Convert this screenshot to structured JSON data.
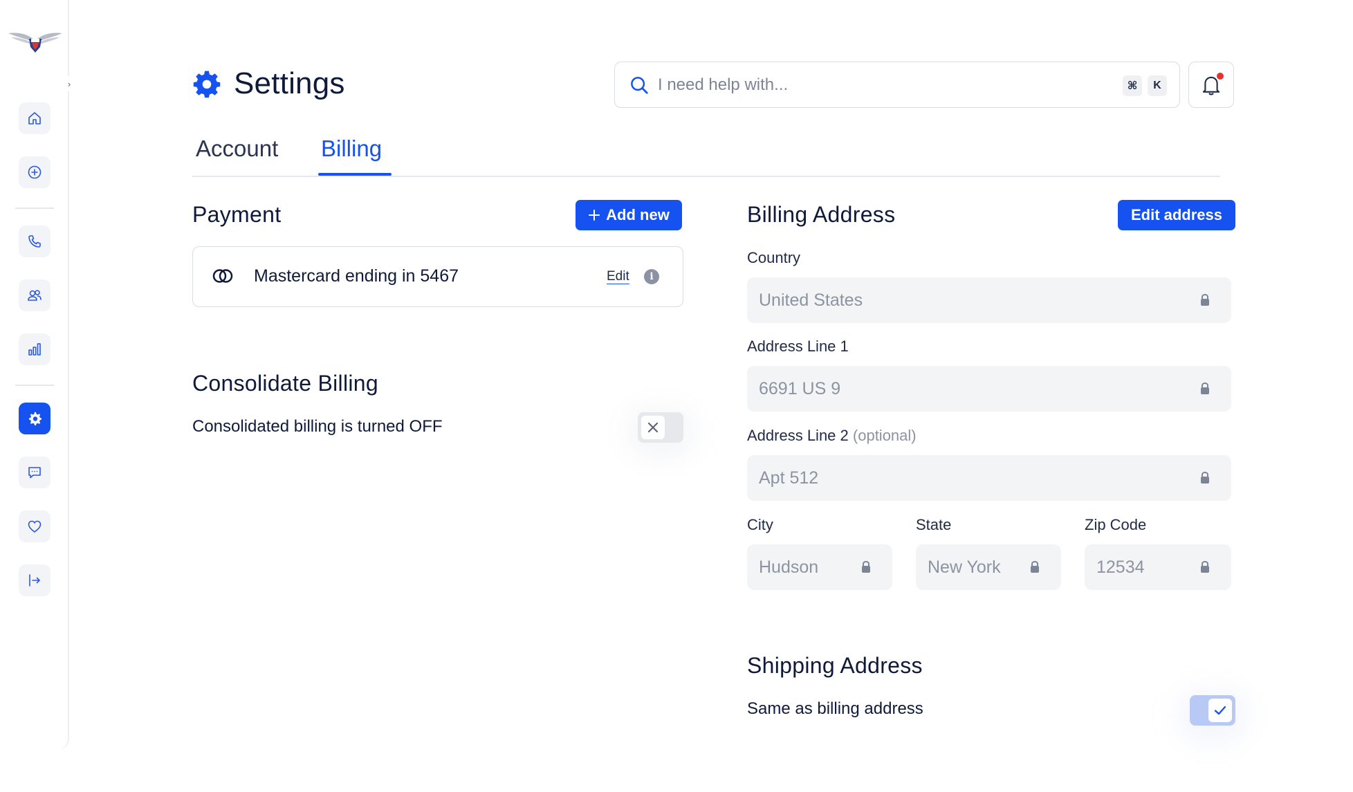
{
  "header": {
    "title": "Settings",
    "search_placeholder": "I need help with...",
    "shortcut_cmd": "⌘",
    "shortcut_key": "K"
  },
  "sidebar": {
    "items": [
      {
        "icon": "home-icon"
      },
      {
        "icon": "plus-circle-icon"
      },
      {
        "icon": "phone-icon"
      },
      {
        "icon": "users-icon"
      },
      {
        "icon": "bar-chart-icon"
      },
      {
        "icon": "gear-icon",
        "active": true
      },
      {
        "icon": "chat-icon"
      },
      {
        "icon": "heart-icon"
      },
      {
        "icon": "logout-icon"
      }
    ]
  },
  "tabs": [
    {
      "label": "Account",
      "active": false
    },
    {
      "label": "Billing",
      "active": true
    }
  ],
  "payment": {
    "title": "Payment",
    "add_button": "Add new",
    "card_label": "Mastercard ending in 5467",
    "edit_label": "Edit"
  },
  "consolidate": {
    "title": "Consolidate Billing",
    "status_text": "Consolidated billing is turned OFF",
    "enabled": false
  },
  "billing_address": {
    "title": "Billing Address",
    "edit_button": "Edit address",
    "country_label": "Country",
    "country_value": "United States",
    "line1_label": "Address Line 1",
    "line1_value": "6691 US 9",
    "line2_label": "Address Line 2",
    "line2_optional": "(optional)",
    "line2_value": "Apt 512",
    "city_label": "City",
    "city_value": "Hudson",
    "state_label": "State",
    "state_value": "New York",
    "zip_label": "Zip Code",
    "zip_value": "12534"
  },
  "shipping": {
    "title": "Shipping Address",
    "same_label": "Same as billing address",
    "same_as_billing": true
  },
  "colors": {
    "accent": "#1652f0",
    "text": "#0f1a3a",
    "field_bg": "#f3f4f6",
    "notification_dot": "#e5322d"
  }
}
